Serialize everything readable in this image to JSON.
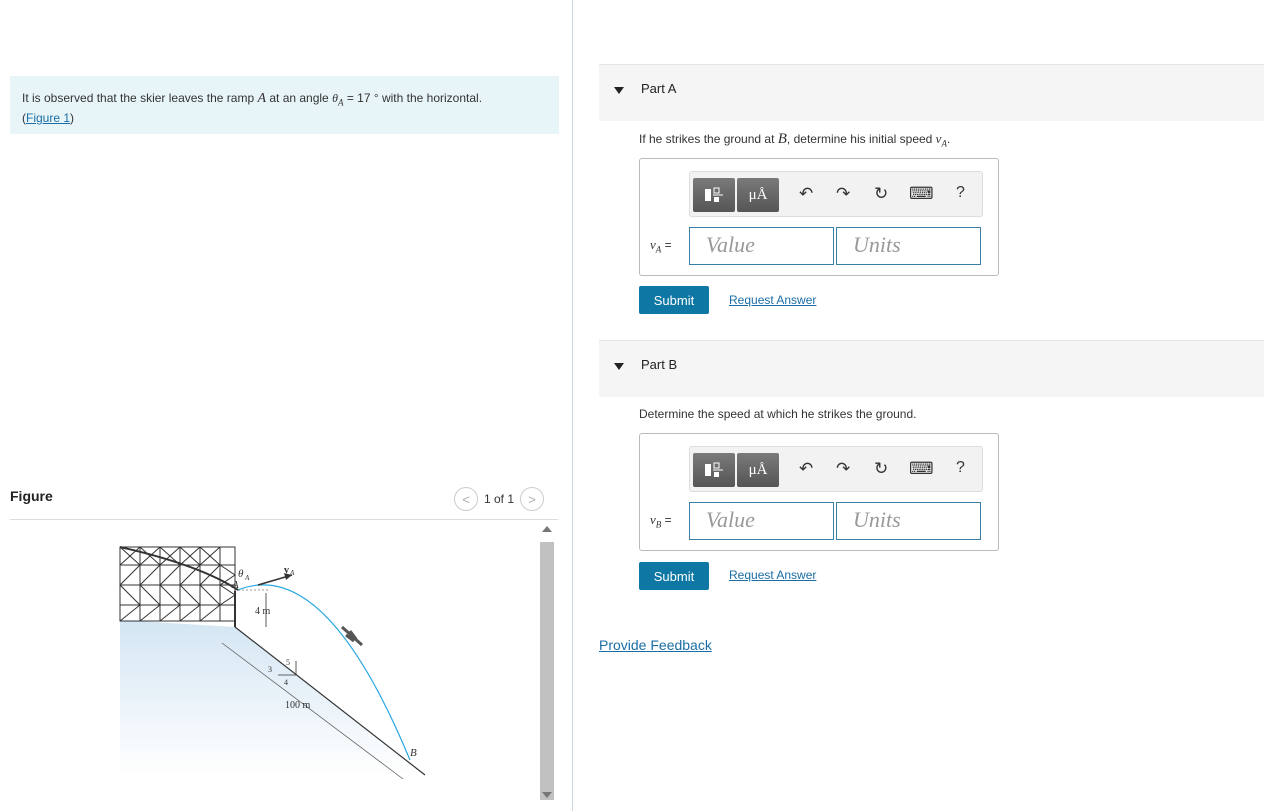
{
  "intro": {
    "text_before": "It is observed that the skier leaves the ramp ",
    "point": "A",
    "text_mid": " at an angle ",
    "angle_symbol": "θ",
    "angle_sub": "A",
    "text_after": " = 17 ° with the horizontal.",
    "figure_link": "Figure 1",
    "open_paren": "(",
    "close_paren": ")"
  },
  "figure": {
    "title": "Figure",
    "pager": "1 of 1",
    "prev_glyph": "<",
    "next_glyph": ">",
    "labels": {
      "theta": "θ",
      "theta_sub": "A",
      "point_a": "A",
      "v": "v",
      "v_sub": "A",
      "height": "4 m",
      "slope_3": "3",
      "slope_4": "4",
      "slope_5": "5",
      "distance": "100 m",
      "point_b": "B"
    }
  },
  "parts": [
    {
      "label": "Part A",
      "question_before": "If he strikes the ground at ",
      "question_var": "B",
      "question_mid": ", determine his initial speed ",
      "question_speed": "v",
      "question_speed_sub": "A",
      "question_after": ".",
      "var": "v",
      "var_sub": "A",
      "eq": " =",
      "value_placeholder": "Value",
      "units_placeholder": "Units",
      "submit": "Submit",
      "request": "Request Answer"
    },
    {
      "label": "Part B",
      "question": "Determine the speed at which he strikes the ground.",
      "var": "v",
      "var_sub": "B",
      "eq": " =",
      "value_placeholder": "Value",
      "units_placeholder": "Units",
      "submit": "Submit",
      "request": "Request Answer"
    }
  ],
  "toolbar": {
    "units_glyph": "μÅ",
    "undo": "↶",
    "redo": "↷",
    "reset": "↻",
    "keyboard": "⌨",
    "help": "?"
  },
  "feedback": "Provide Feedback",
  "colors": {
    "accent": "#0e77a3",
    "link": "#1a6ea5",
    "intro_bg": "#e8f5f8",
    "trajectory": "#29a8e0"
  }
}
